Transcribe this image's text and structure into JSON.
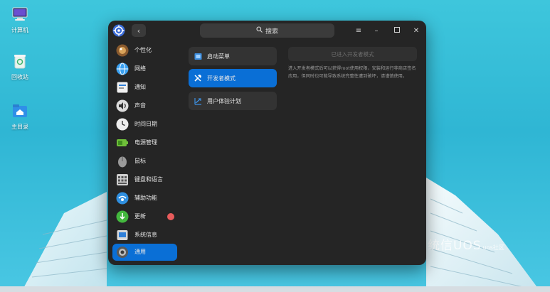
{
  "desktop": {
    "icons": [
      {
        "label": "计算机",
        "icon": "computer-icon"
      },
      {
        "label": "回收站",
        "icon": "trash-icon"
      },
      {
        "label": "主目录",
        "icon": "home-folder-icon"
      }
    ],
    "watermark": {
      "main": "统信UOS",
      "sub": "uos社区"
    }
  },
  "window": {
    "search": {
      "placeholder": "搜索"
    },
    "controls": [
      "menu-icon",
      "minimize-icon",
      "maximize-icon",
      "close-icon"
    ],
    "sidebar": {
      "items": [
        {
          "label": "个性化",
          "icon": "personalization-icon",
          "color": "#c98a4a"
        },
        {
          "label": "网络",
          "icon": "network-icon",
          "color": "#3aa0f0"
        },
        {
          "label": "通知",
          "icon": "notification-icon",
          "color": "#f0f0f0"
        },
        {
          "label": "声音",
          "icon": "sound-icon",
          "color": "#dcdcdc"
        },
        {
          "label": "时间日期",
          "icon": "clock-icon",
          "color": "#eeeeee"
        },
        {
          "label": "电源管理",
          "icon": "power-icon",
          "color": "#6fc03a"
        },
        {
          "label": "鼠标",
          "icon": "mouse-icon",
          "color": "#9a9a9a"
        },
        {
          "label": "键盘和语言",
          "icon": "keyboard-icon",
          "color": "#cfcfcf"
        },
        {
          "label": "辅助功能",
          "icon": "accessibility-icon",
          "color": "#2f8fe0"
        },
        {
          "label": "更新",
          "icon": "update-icon",
          "color": "#43b83e",
          "badge": true
        },
        {
          "label": "系统信息",
          "icon": "system-info-icon",
          "color": "#d8d8d8"
        },
        {
          "label": "通用",
          "icon": "general-icon",
          "color": "#8a8a8a",
          "active": true
        }
      ]
    },
    "middle": {
      "items": [
        {
          "label": "启动菜单",
          "icon": "boot-menu-icon"
        },
        {
          "label": "开发者模式",
          "icon": "developer-tools-icon",
          "active": true
        },
        {
          "label": "用户体验计划",
          "icon": "user-experience-icon"
        }
      ]
    },
    "content": {
      "enter_button": "已进入开发者模式",
      "description": "进入开发者模式后可以获得root使用权限，安装和运行非商店签名应用，但同时也可能导致系统完整性遭到破坏，请谨慎使用。"
    },
    "accent_color": "#0a6fd6"
  }
}
